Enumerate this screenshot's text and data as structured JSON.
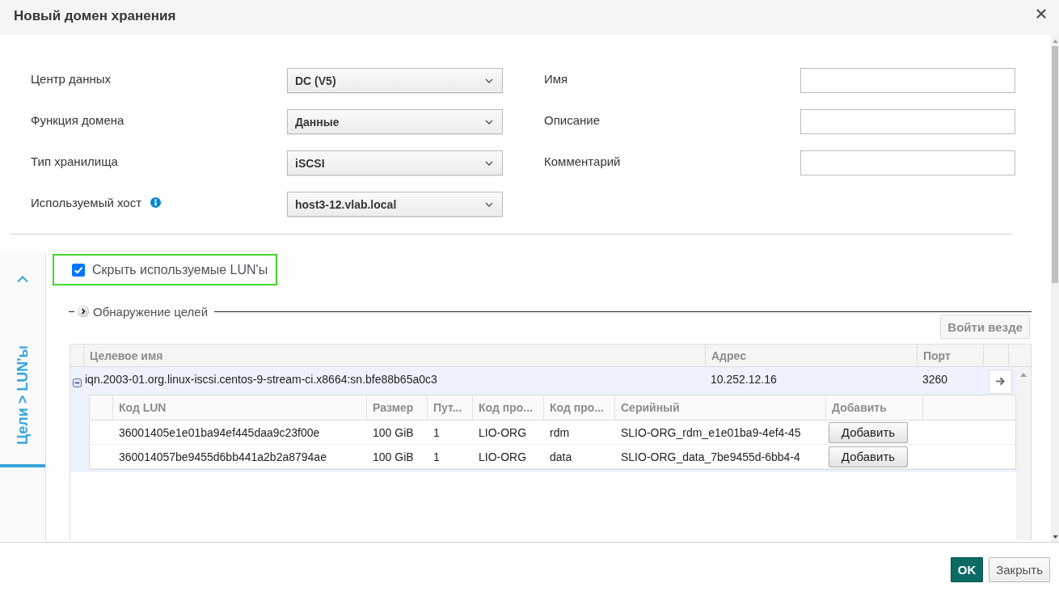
{
  "dialog": {
    "title": "Новый домен хранения"
  },
  "form": {
    "left": [
      {
        "label": "Центр данных",
        "kind": "select",
        "value": "DC (V5)"
      },
      {
        "label": "Функция домена",
        "kind": "select",
        "value": "Данные"
      },
      {
        "label": "Тип хранилища",
        "kind": "select",
        "value": "iSCSI"
      },
      {
        "label": "Используемый хост",
        "kind": "select",
        "value": "host3-12.vlab.local",
        "info": true
      }
    ],
    "right": [
      {
        "label": "Имя",
        "kind": "input"
      },
      {
        "label": "Описание",
        "kind": "input"
      },
      {
        "label": "Комментарий",
        "kind": "input"
      }
    ]
  },
  "side_tabs": [
    {
      "label": "Цели > LUN'ы",
      "selected": true
    }
  ],
  "hide_used_luns": {
    "label": "Скрыть используемые LUN'ы",
    "checked": true,
    "highlighted": true
  },
  "target_discovery": {
    "label": "Обнаружение целей",
    "expanded": false
  },
  "login_all_button": {
    "label": "Войти везде",
    "disabled": true
  },
  "targets_table": {
    "columns": [
      "Целевое имя",
      "Адрес",
      "Порт"
    ],
    "rows": [
      {
        "cells": [
          "iqn.2003-01.org.linux-iscsi.centos-9-stream-ci.x8664:sn.bfe88b65a0c3",
          "10.252.12.16",
          "3260"
        ],
        "selected": true,
        "expanded": true,
        "luns": {
          "columns": [
            "Код LUN",
            "Размер",
            "Пут...",
            "Код про...",
            "Код про...",
            "Серийный",
            "Добавить"
          ],
          "rows": [
            {
              "cells": [
                "36001405e1e01ba94ef445daa9c23f00e",
                "100 GiB",
                "1",
                "LIO-ORG",
                "rdm",
                "SLIO-ORG_rdm_e1e01ba9-4ef4-45"
              ],
              "button": "Добавить"
            },
            {
              "cells": [
                "360014057be9455d6bb441a2b2a8794ae",
                "100 GiB",
                "1",
                "LIO-ORG",
                "data",
                "SLIO-ORG_data_7be9455d-6bb4-4"
              ],
              "button": "Добавить"
            }
          ]
        }
      }
    ]
  },
  "buttons": [
    {
      "label": "OK",
      "kind": "primary"
    },
    {
      "label": "Закрыть",
      "kind": "default"
    }
  ]
}
